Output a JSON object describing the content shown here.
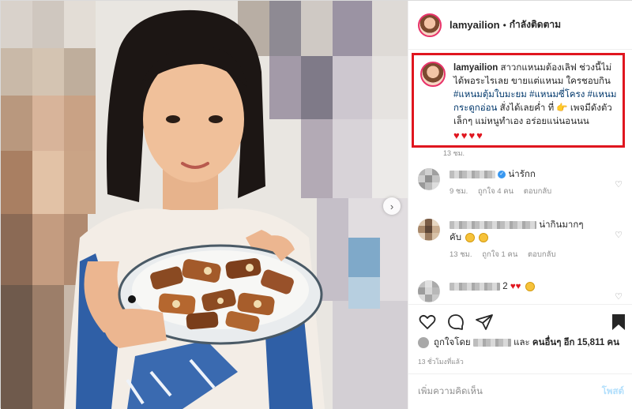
{
  "header": {
    "username": "lamyailion",
    "separator": "•",
    "follow_status": "กำลังติดตาม"
  },
  "caption": {
    "username": "lamyailion",
    "line1": "สาวกแหนมต้องเลิฟ ช่วงนี้ไม่ได้พอระไรเลย ขายแต่แหนม ใครชอบกิน",
    "tag1": "#แหนมตุ้มใบมะยม",
    "tag2": "#แหนมซี่โครง",
    "tag3": "#แหนมกระดูกอ่อน",
    "line2": "สั่งได้เลยค่ำ ที่",
    "line3": "เพจมีดังตัวเล็กๆ แม่หนูทำเอง อร่อยแน่นอนนน",
    "hearts": "♥♥♥♥",
    "time": "13 ชม."
  },
  "comments": [
    {
      "text": "น่ารักก",
      "time": "9 ชม.",
      "likes": "ถูกใจ 4 คน",
      "reply": "ตอบกลับ"
    },
    {
      "text": "น่ากินมากๆ",
      "text2": "คับ",
      "time": "13 ชม.",
      "likes": "ถูกใจ 1 คน",
      "reply": "ตอบกลับ"
    },
    {
      "text": "2",
      "hearts": "♥♥"
    }
  ],
  "likes": {
    "prefix": "ถูกใจโดย",
    "and_others": "และ",
    "others_text": "คนอื่นๆ อีก 15,811 คน"
  },
  "post_time": "13 ชั่วโมงที่แล้ว",
  "add_comment": {
    "placeholder": "เพิ่มความคิดเห็น",
    "post_label": "โพสต์"
  },
  "icons": {
    "like": "heart-icon",
    "comment": "comment-icon",
    "share": "share-icon",
    "save": "bookmark-icon",
    "next": "chevron-right-icon"
  },
  "colors": {
    "highlight_border": "#e0161f",
    "hashtag": "#00376b",
    "post_disabled": "#b2dffc"
  }
}
